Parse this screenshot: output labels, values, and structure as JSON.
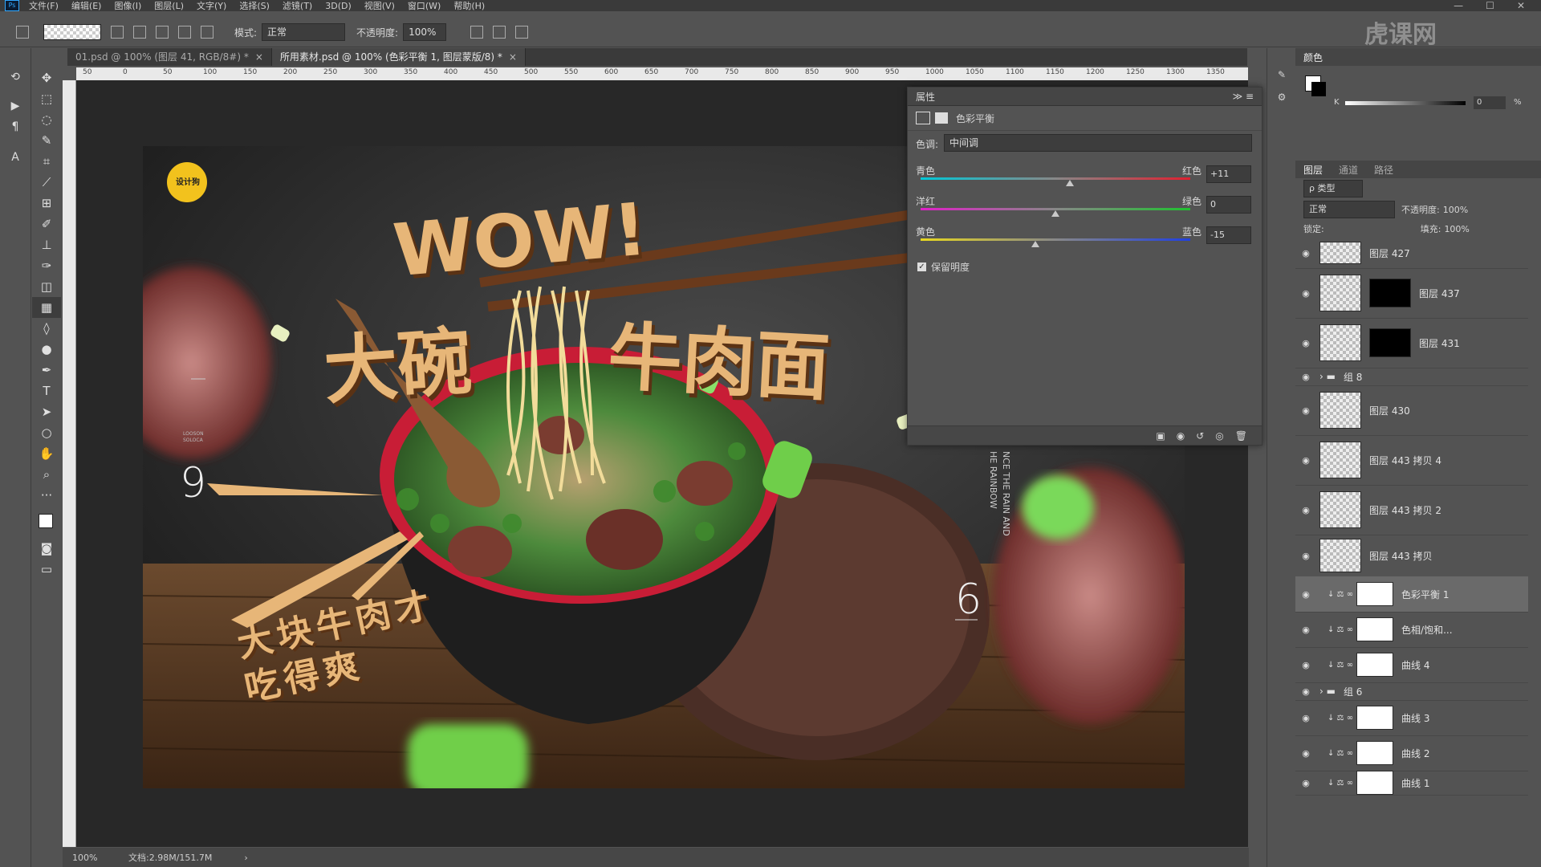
{
  "app": {
    "logo": "Ps"
  },
  "menu": [
    "文件(F)",
    "编辑(E)",
    "图像(I)",
    "图层(L)",
    "文字(Y)",
    "选择(S)",
    "滤镜(T)",
    "3D(D)",
    "视图(V)",
    "窗口(W)",
    "帮助(H)"
  ],
  "window_controls": [
    "—",
    "☐",
    "✕"
  ],
  "options": {
    "mode_label": "模式:",
    "mode_value": "正常",
    "opacity_label": "不透明度:",
    "opacity_value": "100%"
  },
  "tabs": [
    {
      "label": "01.psd @ 100% (图层 41, RGB/8#) *",
      "active": false
    },
    {
      "label": "所用素材.psd @ 100% (色彩平衡 1, 图层蒙版/8) *",
      "active": true
    }
  ],
  "tab_close": "×",
  "ruler_ticks": [
    "50",
    "0",
    "50",
    "100",
    "150",
    "200",
    "250",
    "300",
    "350",
    "400",
    "450",
    "500",
    "550",
    "600",
    "650",
    "700",
    "750",
    "800",
    "850",
    "900",
    "950",
    "1000",
    "1050",
    "1100",
    "1150",
    "1200",
    "1250",
    "1300",
    "1350"
  ],
  "status": {
    "zoom": "100%",
    "doc": "文档:2.98M/151.7M",
    "arrow": "›"
  },
  "properties": {
    "title": "属性",
    "subtitle": "色彩平衡",
    "tone_label": "色调:",
    "tone_value": "中间调",
    "sliders": [
      {
        "left": "青色",
        "right": "红色",
        "value": "+11",
        "level": 11
      },
      {
        "left": "洋红",
        "right": "绿色",
        "value": "0",
        "level": 0
      },
      {
        "left": "黄色",
        "right": "蓝色",
        "value": "-15",
        "level": -15
      }
    ],
    "preserve_label": "保留明度",
    "preserve_checked": true
  },
  "color_panel": {
    "title": "颜色",
    "k_label": "K",
    "k_value": "0",
    "pct": "%"
  },
  "layers_panel": {
    "tabs": [
      "图层",
      "通道",
      "路径"
    ],
    "filter_label": "ρ 类型",
    "blend_mode": "正常",
    "opacity_label": "不透明度:",
    "opacity_value": "100%",
    "lock_label": "锁定:",
    "fill_label": "填充:",
    "fill_value": "100%",
    "layers": [
      {
        "name": "图层 427",
        "kind": "image"
      },
      {
        "name": "图层 437",
        "kind": "image-mask"
      },
      {
        "name": "图层 431",
        "kind": "image-mask"
      },
      {
        "name": "组 8",
        "kind": "group"
      },
      {
        "name": "图层 430",
        "kind": "image"
      },
      {
        "name": "图层 443 拷贝 4",
        "kind": "image"
      },
      {
        "name": "图层 443 拷贝 2",
        "kind": "image"
      },
      {
        "name": "图层 443 拷贝",
        "kind": "image"
      },
      {
        "name": "色彩平衡 1",
        "kind": "adjust",
        "selected": true
      },
      {
        "name": "色相/饱和...",
        "kind": "adjust"
      },
      {
        "name": "曲线 4",
        "kind": "adjust"
      },
      {
        "name": "组 6",
        "kind": "group"
      },
      {
        "name": "曲线 3",
        "kind": "adjust"
      },
      {
        "name": "曲线 2",
        "kind": "adjust"
      },
      {
        "name": "曲线 1",
        "kind": "adjust"
      }
    ]
  },
  "artwork": {
    "logo_text": "设计狗",
    "wow": "WOW!",
    "headline_1": "大碗",
    "headline_2": "牛肉面",
    "slogan_1": "大块牛肉才",
    "slogan_2": "吃得爽",
    "left_small": "LOOSON\nSOLOCA",
    "num_left": "9",
    "num_right": "6",
    "vertical_1": "NCE THE RAIN AND",
    "vertical_2": "HE RAINBOW"
  },
  "watermark": "虎课网",
  "colors": {
    "accent": "#31a8ff",
    "title_fill": "#e7b678",
    "title_shadow": "#5a3214",
    "bowl_red": "#c81d36"
  }
}
